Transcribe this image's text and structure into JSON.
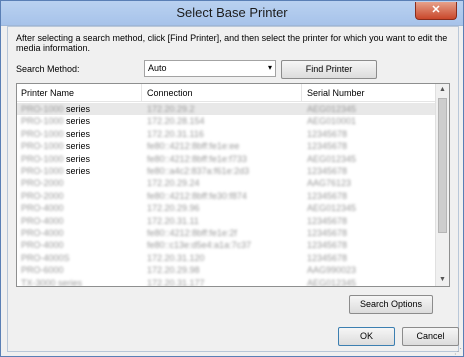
{
  "window": {
    "title": "Select Base Printer",
    "close_glyph": "✕"
  },
  "instruction": "After selecting a search method, click [Find Printer], and then select the printer for which you want to edit the media information.",
  "search": {
    "label": "Search Method:",
    "selected": "Auto",
    "dropdown_icon": "chevron-down-icon"
  },
  "buttons": {
    "find_printer": "Find Printer",
    "search_options": "Search Options",
    "ok": "OK",
    "cancel": "Cancel"
  },
  "list": {
    "columns": [
      "Printer Name",
      "Connection",
      "Serial Number"
    ],
    "rows": [
      {
        "model": "PRO-1000",
        "suffix": "series",
        "connection": "172.20.29.2",
        "serial": "AEG012345"
      },
      {
        "model": "PRO-1000",
        "suffix": "series",
        "connection": "172.20.28.154",
        "serial": "AEG010001"
      },
      {
        "model": "PRO-1000",
        "suffix": "series",
        "connection": "172.20.31.116",
        "serial": "12345678"
      },
      {
        "model": "PRO-1000",
        "suffix": "series",
        "connection": "fe80::4212:8bff:fe1e:ee",
        "serial": "12345678"
      },
      {
        "model": "PRO-1000",
        "suffix": "series",
        "connection": "fe80::4212:8bff:fe1e:f733",
        "serial": "AEG012345"
      },
      {
        "model": "PRO-1000",
        "suffix": "series",
        "connection": "fe80::a4c2:837a:f61e:2d3",
        "serial": "12345678"
      },
      {
        "model": "PRO-2000",
        "suffix": "",
        "connection": "172.20.29.24",
        "serial": "AAG76123"
      },
      {
        "model": "PRO-2000",
        "suffix": "",
        "connection": "fe80::4212:8bff:fe30:f874",
        "serial": "12345678"
      },
      {
        "model": "PRO-4000",
        "suffix": "",
        "connection": "172.20.29.96",
        "serial": "AEG012345"
      },
      {
        "model": "PRO-4000",
        "suffix": "",
        "connection": "172.20.31.11",
        "serial": "12345678"
      },
      {
        "model": "PRO-4000",
        "suffix": "",
        "connection": "fe80::4212:8bff:fe1e:2f",
        "serial": "12345678"
      },
      {
        "model": "PRO-4000",
        "suffix": "",
        "connection": "fe80::c13e:d5e4:a1a:7c37",
        "serial": "12345678"
      },
      {
        "model": "PRO-4000S",
        "suffix": "",
        "connection": "172.20.31.120",
        "serial": "12345678"
      },
      {
        "model": "PRO-6000",
        "suffix": "",
        "connection": "172.20.29.98",
        "serial": "AAG990023"
      },
      {
        "model": "TX-3000 series",
        "suffix": "",
        "connection": "172.20.31.177",
        "serial": "AEG012345"
      }
    ]
  }
}
